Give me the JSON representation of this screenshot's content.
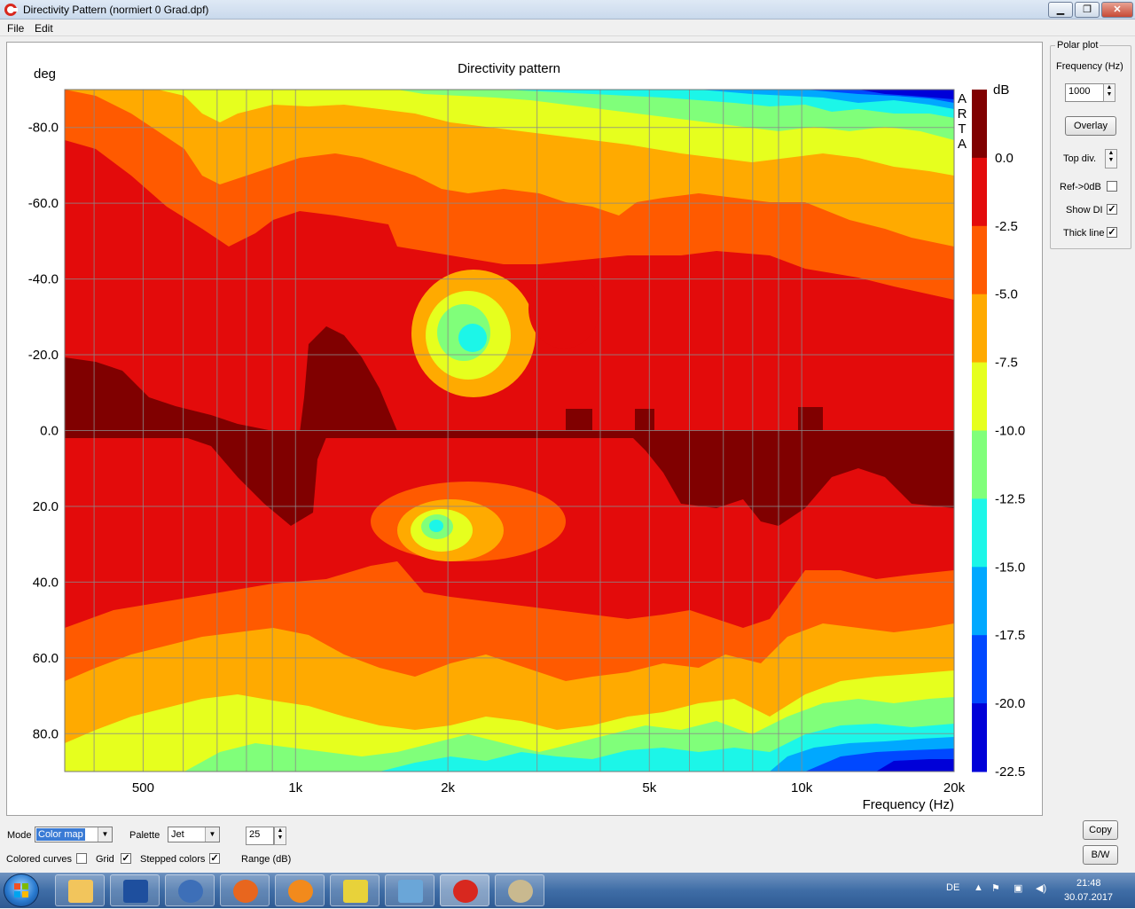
{
  "window": {
    "title": "Directivity Pattern  (normiert 0 Grad.dpf)",
    "minimize": "▁",
    "maximize": "❐",
    "close": "✕"
  },
  "menu": [
    "File",
    "Edit"
  ],
  "plot": {
    "title": "Directivity pattern",
    "y_unit_label": "deg",
    "x_axis_label": "Frequency (Hz)",
    "colorbar_unit": "dB",
    "watermark": [
      "A",
      "R",
      "T",
      "A"
    ]
  },
  "chart_data": {
    "type": "heatmap",
    "title": "Directivity pattern",
    "xlabel": "Frequency (Hz)",
    "ylabel": "deg",
    "x_scale": "log",
    "xlim": [
      350,
      20000
    ],
    "ylim": [
      -90,
      90
    ],
    "y_inverted": true,
    "x_ticks": [
      500,
      1000,
      2000,
      5000,
      10000,
      20000
    ],
    "x_tick_labels": [
      "500",
      "1k",
      "2k",
      "5k",
      "10k",
      "20k"
    ],
    "y_ticks": [
      -80,
      -60,
      -40,
      -20,
      0,
      20,
      40,
      60,
      80
    ],
    "y_tick_labels": [
      "-80.0",
      "-60.0",
      "-40.0",
      "-20.0",
      "0.0",
      "20.0",
      "40.0",
      "60.0",
      "80.0"
    ],
    "grid": true,
    "colorbar": {
      "unit": "dB",
      "levels": [
        0.0,
        -2.5,
        -5.0,
        -7.5,
        -10.0,
        -12.5,
        -15.0,
        -17.5,
        -20.0,
        -22.5
      ],
      "labels": [
        "0.0",
        "-2.5",
        "-5.0",
        "-7.5",
        "-10.0",
        "-12.5",
        "-15.0",
        "-17.5",
        "-20.0",
        "-22.5"
      ],
      "colors": [
        "#800000",
        "#e30b0b",
        "#ff5a00",
        "#ffaa00",
        "#e6ff1e",
        "#80ff7a",
        "#1cf6e8",
        "#00a8ff",
        "#0048ff",
        "#0000d8"
      ]
    },
    "palette": "Jet"
  },
  "side_panel": {
    "group_title": "Polar plot",
    "frequency_label": "Frequency (Hz)",
    "frequency_value": "1000",
    "overlay_label": "Overlay",
    "top_div_label": "Top div.",
    "ref_label": "Ref->0dB",
    "ref_checked": "",
    "show_di_label": "Show DI",
    "show_di_checked": "✓",
    "thick_line_label": "Thick line",
    "thick_line_checked": "✓"
  },
  "bottom": {
    "mode_label": "Mode",
    "mode_value": "Color map",
    "palette_label": "Palette",
    "palette_value": "Jet",
    "range_value": "25",
    "range_label": "Range (dB)",
    "colored_curves_label": "Colored curves",
    "colored_curves_checked": "",
    "grid_label": "Grid",
    "grid_checked": "✓",
    "stepped_colors_label": "Stepped colors",
    "stepped_colors_checked": "✓",
    "copy_label": "Copy",
    "bw_label": "B/W"
  },
  "taskbar": {
    "language": "DE",
    "time": "21:48",
    "date": "30.07.2017"
  }
}
